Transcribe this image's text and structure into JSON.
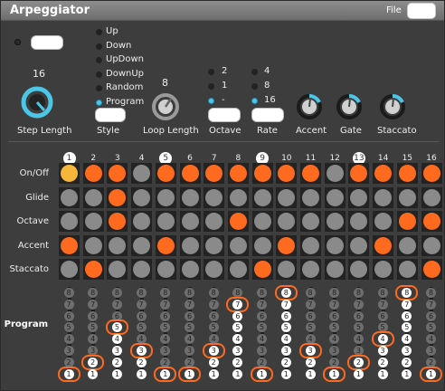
{
  "window": {
    "title": "Arpeggiator",
    "file_label": "File"
  },
  "step_length": {
    "value": "16",
    "label": "Step Length"
  },
  "style": {
    "options": [
      "Up",
      "Down",
      "UpDown",
      "DownUp",
      "Random",
      "Program"
    ],
    "selected": "Program",
    "label": "Style"
  },
  "loop_length": {
    "value": "8",
    "label": "Loop Length"
  },
  "octave": {
    "options": [
      "2",
      "1",
      "-"
    ],
    "selected": "-",
    "label": "Octave"
  },
  "rate": {
    "options": [
      "4",
      "8",
      "16"
    ],
    "selected": "16",
    "label": "Rate"
  },
  "knobs": [
    {
      "label": "Accent"
    },
    {
      "label": "Gate"
    },
    {
      "label": "Staccato"
    }
  ],
  "colors": {
    "accent": "#4cc6e6",
    "active": "#ff6a1f",
    "first_step": "#f5b63a",
    "inactive": "#8a8a8a"
  },
  "grid": {
    "steps": [
      "1",
      "2",
      "3",
      "4",
      "5",
      "6",
      "7",
      "8",
      "9",
      "10",
      "11",
      "12",
      "13",
      "14",
      "15",
      "16"
    ],
    "highlighted_steps": [
      1,
      5,
      9,
      13
    ],
    "rows": [
      {
        "label": "On/Off",
        "cells": [
          "yellow",
          "orange",
          "orange",
          "gray",
          "orange",
          "orange",
          "orange",
          "orange",
          "orange",
          "orange",
          "orange",
          "gray",
          "orange",
          "orange",
          "orange",
          "orange"
        ]
      },
      {
        "label": "Glide",
        "cells": [
          "gray",
          "gray",
          "orange",
          "gray",
          "gray",
          "gray",
          "gray",
          "gray",
          "gray",
          "gray",
          "gray",
          "gray",
          "gray",
          "gray",
          "gray",
          "gray"
        ]
      },
      {
        "label": "Octave",
        "cells": [
          "gray",
          "gray",
          "orange",
          "gray",
          "gray",
          "gray",
          "gray",
          "orange",
          "gray",
          "gray",
          "gray",
          "gray",
          "gray",
          "gray",
          "orange",
          "orange"
        ]
      },
      {
        "label": "Accent",
        "cells": [
          "orange",
          "gray",
          "gray",
          "gray",
          "orange",
          "gray",
          "gray",
          "gray",
          "gray",
          "orange",
          "gray",
          "gray",
          "gray",
          "orange",
          "gray",
          "gray"
        ]
      },
      {
        "label": "Staccato",
        "cells": [
          "gray",
          "orange",
          "gray",
          "gray",
          "gray",
          "gray",
          "gray",
          "gray",
          "orange",
          "gray",
          "gray",
          "gray",
          "gray",
          "gray",
          "gray",
          "orange"
        ]
      }
    ]
  },
  "program": {
    "label": "Program",
    "dot_labels": [
      "8",
      "7",
      "6",
      "5",
      "4",
      "3",
      "2",
      "1"
    ],
    "selected_per_step": [
      1,
      2,
      5,
      3,
      1,
      1,
      3,
      7,
      1,
      8,
      3,
      1,
      2,
      4,
      8,
      1
    ]
  }
}
